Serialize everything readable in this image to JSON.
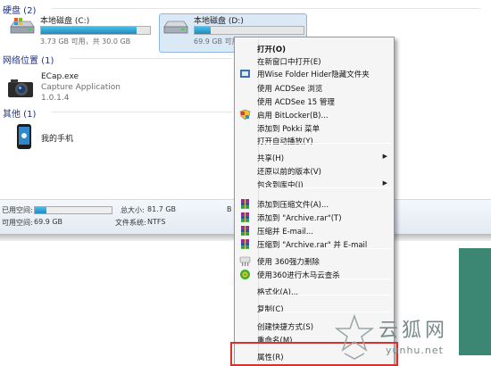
{
  "explorer": {
    "groups": {
      "hard_disks": "硬盘 (2)",
      "network": "网络位置 (1)",
      "other": "其他 (1)"
    },
    "drives": [
      {
        "name": "本地磁盘 (C:)",
        "free_text": "3.73 GB 可用，共 30.0 GB",
        "used_fraction": 0.88
      },
      {
        "name": "本地磁盘 (D:)",
        "free_text": "69.9 GB 可用",
        "used_fraction": 0.15
      }
    ],
    "network_item": {
      "name": "ECap.exe",
      "description": "Capture Application",
      "version": "1.0.1.4"
    },
    "other_item": {
      "name": "我的手机"
    },
    "details": {
      "used_label": "已用空间:",
      "free_label": "可用空间:",
      "free_value": "69.9 GB",
      "total_label": "总大小:",
      "total_value": "81.7 GB",
      "fs_label": "文件系统:",
      "fs_value": "NTFS",
      "truncated": "B",
      "used_fraction": 0.15
    }
  },
  "context_menu": {
    "items": [
      {
        "label": "打开(O)",
        "bold": true
      },
      {
        "label": "在新窗口中打开(E)"
      },
      {
        "label": "用Wise Folder Hider隐藏文件夹",
        "icon": "wise-folder-hider-icon"
      },
      {
        "label": "使用 ACDSee 浏览"
      },
      {
        "label": "使用 ACDSee 15 管理"
      },
      {
        "label": "启用 BitLocker(B)...",
        "icon": "bitlocker-shield-icon"
      },
      {
        "label": "添加到 Pokki 菜单"
      },
      {
        "label": "打开自动播放(Y)..."
      },
      {
        "label": "共享(H)",
        "submenu": true
      },
      {
        "label": "还原以前的版本(V)"
      },
      {
        "label": "包含到库中(I)",
        "submenu": true
      },
      {
        "label": "添加到压缩文件(A)...",
        "icon": "winrar-icon"
      },
      {
        "label": "添加到 \"Archive.rar\"(T)",
        "icon": "winrar-icon"
      },
      {
        "label": "压缩并 E-mail...",
        "icon": "winrar-icon"
      },
      {
        "label": "压缩到 \"Archive.rar\" 并 E-mail",
        "icon": "winrar-icon"
      },
      {
        "label": "使用 360强力删除",
        "icon": "360-shred-icon"
      },
      {
        "label": "使用360进行木马云查杀",
        "icon": "360-scan-icon"
      },
      {
        "label": "格式化(A)..."
      },
      {
        "label": "复制(C)"
      },
      {
        "label": "创建快捷方式(S)"
      },
      {
        "label": "重命名(M)"
      },
      {
        "label": "属性(R)"
      }
    ],
    "submenu_arrow": "▶"
  },
  "watermark": {
    "brand_cn": "云狐网",
    "url": "yunhu.net"
  },
  "colors": {
    "group_title": "#1e3287",
    "highlight": "#d6312f",
    "bar_fill": "#1f8bbd",
    "selection": "#dbe9f7"
  }
}
